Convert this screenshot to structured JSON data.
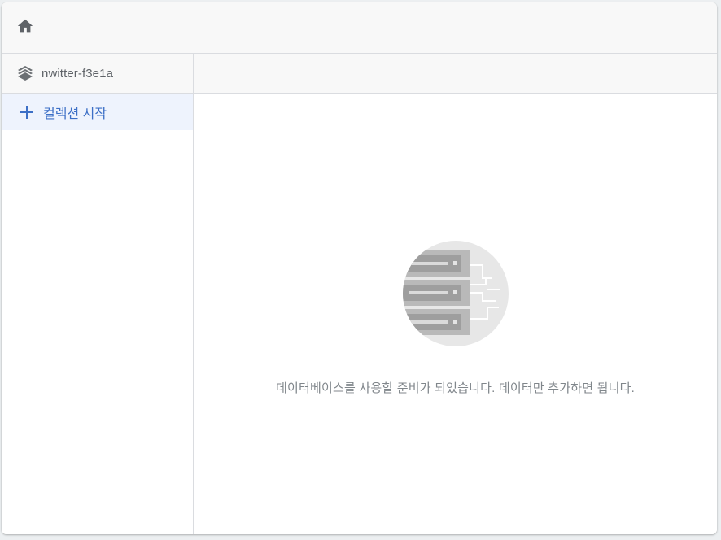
{
  "topbar": {
    "home_icon": "home-icon"
  },
  "left_panel": {
    "database_icon": "database-layers-icon",
    "database_name": "nwitter-f3e1a",
    "start_collection_icon": "plus-icon",
    "start_collection_label": "컬렉션 시작"
  },
  "main": {
    "illustration": "database-servers-illustration",
    "empty_message": "데이터베이스를 사용할 준비가 되었습니다. 데이터만 추가하면 됩니다."
  },
  "colors": {
    "accent": "#3c6fc6",
    "selected_bg": "#eef3fd",
    "header_bg": "#f8f8f8",
    "border": "#dadce0",
    "muted_text": "#80868b"
  }
}
